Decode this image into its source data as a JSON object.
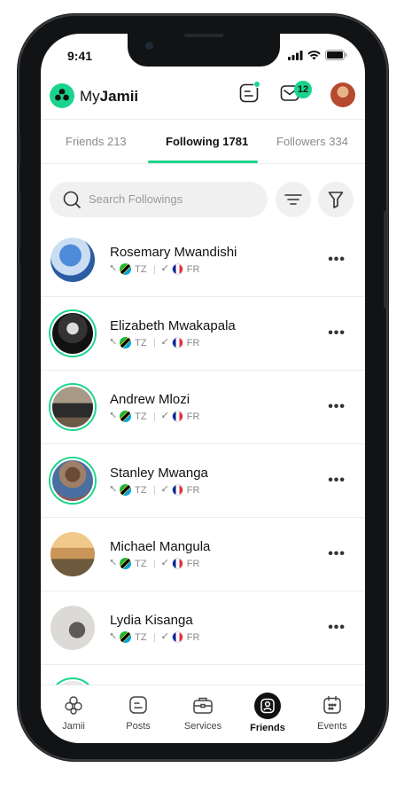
{
  "status": {
    "time": "9:41"
  },
  "header": {
    "brand_prefix": "My",
    "brand_bold": "Jamii",
    "messages_badge": "12"
  },
  "tabs": [
    {
      "label": "Friends 213"
    },
    {
      "label": "Following 1781",
      "active": true
    },
    {
      "label": "Followers 334"
    }
  ],
  "search": {
    "placeholder": "Search Followings"
  },
  "list": [
    {
      "name": "Rosemary Mwandishi",
      "from": "TZ",
      "to": "FR",
      "ring": false
    },
    {
      "name": "Elizabeth Mwakapala",
      "from": "TZ",
      "to": "FR",
      "ring": true
    },
    {
      "name": "Andrew Mlozi",
      "from": "TZ",
      "to": "FR",
      "ring": true
    },
    {
      "name": "Stanley Mwanga",
      "from": "TZ",
      "to": "FR",
      "ring": true
    },
    {
      "name": "Michael Mangula",
      "from": "TZ",
      "to": "FR",
      "ring": false
    },
    {
      "name": "Lydia Kisanga",
      "from": "TZ",
      "to": "FR",
      "ring": false
    }
  ],
  "more_glyph": "•••",
  "nav": [
    {
      "label": "Jamii",
      "icon": "flower-icon"
    },
    {
      "label": "Posts",
      "icon": "posts-icon"
    },
    {
      "label": "Services",
      "icon": "briefcase-icon"
    },
    {
      "label": "Friends",
      "icon": "person-icon",
      "active": true
    },
    {
      "label": "Events",
      "icon": "calendar-icon"
    }
  ],
  "colors": {
    "accent": "#19d48c",
    "text": "#111111",
    "muted": "#8a8a8a"
  }
}
